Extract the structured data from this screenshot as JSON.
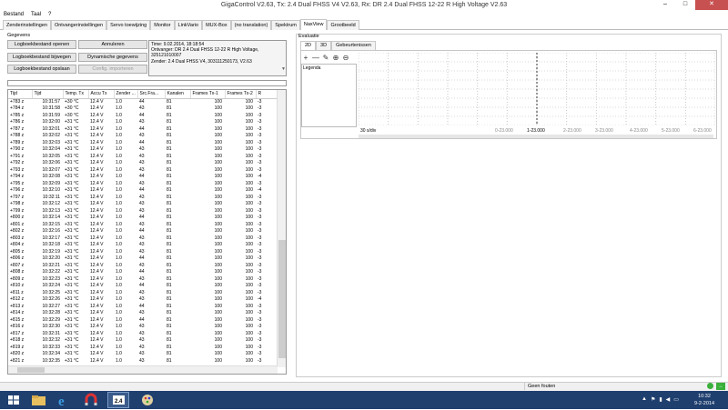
{
  "window": {
    "title": "GigaControl     V2.63,   Tx: 2.4 Dual FHSS V4 V2.63,   Rx: DR 2.4 Dual FHSS 12-22 R High Voltage V2.63",
    "controls": [
      "–",
      "□",
      "✕"
    ]
  },
  "menu": [
    "Bestand",
    "Taal",
    "?"
  ],
  "tabs": [
    "Zenderinstellingen",
    "Ontvangerinstellingen",
    "Servo toewijzing",
    "Monitor",
    "LinkVario",
    "MUX-Box",
    "(no translation)",
    "Spektrum",
    "NaxView",
    "Grootbeeld"
  ],
  "active_tab": "NaxView",
  "gegevens": {
    "label": "Gegevens",
    "buttons": {
      "open": "Logboekbestand openen",
      "cancel": "Annuleren",
      "update": "Logboekbestand bijwegen",
      "dynamic": "Dynamische gegevens",
      "save": "Logboekbestand opslaan",
      "config": "Config. importeren"
    },
    "info": {
      "time": "Time: 9.02.2014, 18:18:54",
      "receiver": "Ontvanger:   DR 2.4 Dual FHSS 12-22 R High Voltage,",
      "receiver_id": "325121010007",
      "transmitter": "Zender:   2.4 Dual FHSS V4, 303111250173, V2.63"
    }
  },
  "table": {
    "columns": [
      "Tijd",
      "Tijd",
      "Temp. Tx",
      "Accu Tx",
      "Zender ...",
      "Src.Fra...",
      "Kanalen",
      "Frames Tx-1",
      "Frames Tx-2",
      "R"
    ],
    "rows": [
      [
        "+783 z",
        "10:31:57",
        "+30 °C",
        "12.4 V",
        "1.0",
        "44",
        "81",
        "100",
        "100",
        "-3"
      ],
      [
        "+784 z",
        "10:31:58",
        "+30 °C",
        "12.4 V",
        "1.0",
        "43",
        "81",
        "100",
        "100",
        "-3"
      ],
      [
        "+785 z",
        "10:31:59",
        "+30 °C",
        "12.4 V",
        "1.0",
        "44",
        "81",
        "100",
        "100",
        "-3"
      ],
      [
        "+786 z",
        "10:32:00",
        "+31 °C",
        "12.4 V",
        "1.0",
        "43",
        "81",
        "100",
        "100",
        "-3"
      ],
      [
        "+787 z",
        "10:32:01",
        "+31 °C",
        "12.4 V",
        "1.0",
        "44",
        "81",
        "100",
        "100",
        "-3"
      ],
      [
        "+788 z",
        "10:32:02",
        "+31 °C",
        "12.4 V",
        "1.0",
        "43",
        "81",
        "100",
        "100",
        "-3"
      ],
      [
        "+789 z",
        "10:32:03",
        "+31 °C",
        "12.4 V",
        "1.0",
        "44",
        "81",
        "100",
        "100",
        "-3"
      ],
      [
        "+790 z",
        "10:32:04",
        "+31 °C",
        "12.4 V",
        "1.0",
        "43",
        "81",
        "100",
        "100",
        "-3"
      ],
      [
        "+791 z",
        "10:32:05",
        "+31 °C",
        "12.4 V",
        "1.0",
        "43",
        "81",
        "100",
        "100",
        "-3"
      ],
      [
        "+792 z",
        "10:32:06",
        "+31 °C",
        "12.4 V",
        "1.0",
        "43",
        "81",
        "100",
        "100",
        "-3"
      ],
      [
        "+793 z",
        "10:32:07",
        "+31 °C",
        "12.4 V",
        "1.0",
        "43",
        "81",
        "100",
        "100",
        "-3"
      ],
      [
        "+794 z",
        "10:32:08",
        "+31 °C",
        "12.4 V",
        "1.0",
        "44",
        "81",
        "100",
        "100",
        "-4"
      ],
      [
        "+795 z",
        "10:32:09",
        "+31 °C",
        "12.4 V",
        "1.0",
        "43",
        "81",
        "100",
        "100",
        "-3"
      ],
      [
        "+796 z",
        "10:32:10",
        "+31 °C",
        "12.4 V",
        "1.0",
        "44",
        "81",
        "100",
        "100",
        "-4"
      ],
      [
        "+797 z",
        "10:32:11",
        "+31 °C",
        "12.4 V",
        "1.0",
        "43",
        "81",
        "100",
        "100",
        "-3"
      ],
      [
        "+798 z",
        "10:32:12",
        "+31 °C",
        "12.4 V",
        "1.0",
        "43",
        "81",
        "100",
        "100",
        "-3"
      ],
      [
        "+799 z",
        "10:32:13",
        "+31 °C",
        "12.4 V",
        "1.0",
        "43",
        "81",
        "100",
        "100",
        "-3"
      ],
      [
        "+800 z",
        "10:32:14",
        "+31 °C",
        "12.4 V",
        "1.0",
        "44",
        "81",
        "100",
        "100",
        "-3"
      ],
      [
        "+801 z",
        "10:32:15",
        "+31 °C",
        "12.4 V",
        "1.0",
        "43",
        "81",
        "100",
        "100",
        "-3"
      ],
      [
        "+802 z",
        "10:32:16",
        "+31 °C",
        "12.4 V",
        "1.0",
        "44",
        "81",
        "100",
        "100",
        "-3"
      ],
      [
        "+803 z",
        "10:32:17",
        "+31 °C",
        "12.4 V",
        "1.0",
        "43",
        "81",
        "100",
        "100",
        "-3"
      ],
      [
        "+804 z",
        "10:32:18",
        "+31 °C",
        "12.4 V",
        "1.0",
        "43",
        "81",
        "100",
        "100",
        "-3"
      ],
      [
        "+805 z",
        "10:32:19",
        "+31 °C",
        "12.4 V",
        "1.0",
        "43",
        "81",
        "100",
        "100",
        "-3"
      ],
      [
        "+806 z",
        "10:32:20",
        "+31 °C",
        "12.4 V",
        "1.0",
        "44",
        "81",
        "100",
        "100",
        "-3"
      ],
      [
        "+807 z",
        "10:32:21",
        "+31 °C",
        "12.4 V",
        "1.0",
        "43",
        "81",
        "100",
        "100",
        "-3"
      ],
      [
        "+808 z",
        "10:32:22",
        "+31 °C",
        "12.4 V",
        "1.0",
        "44",
        "81",
        "100",
        "100",
        "-3"
      ],
      [
        "+809 z",
        "10:32:23",
        "+31 °C",
        "12.4 V",
        "1.0",
        "43",
        "81",
        "100",
        "100",
        "-3"
      ],
      [
        "+810 z",
        "10:32:24",
        "+31 °C",
        "12.4 V",
        "1.0",
        "44",
        "81",
        "100",
        "100",
        "-3"
      ],
      [
        "+811 z",
        "10:32:25",
        "+31 °C",
        "12.4 V",
        "1.0",
        "43",
        "81",
        "100",
        "100",
        "-3"
      ],
      [
        "+812 z",
        "10:32:26",
        "+31 °C",
        "12.4 V",
        "1.0",
        "43",
        "81",
        "100",
        "100",
        "-4"
      ],
      [
        "+813 z",
        "10:32:27",
        "+31 °C",
        "12.4 V",
        "1.0",
        "44",
        "81",
        "100",
        "100",
        "-3"
      ],
      [
        "+814 z",
        "10:32:28",
        "+31 °C",
        "12.4 V",
        "1.0",
        "43",
        "81",
        "100",
        "100",
        "-3"
      ],
      [
        "+815 z",
        "10:32:29",
        "+31 °C",
        "12.4 V",
        "1.0",
        "44",
        "81",
        "100",
        "100",
        "-3"
      ],
      [
        "+816 z",
        "10:32:30",
        "+31 °C",
        "12.4 V",
        "1.0",
        "43",
        "81",
        "100",
        "100",
        "-3"
      ],
      [
        "+817 z",
        "10:32:31",
        "+31 °C",
        "12.4 V",
        "1.0",
        "43",
        "81",
        "100",
        "100",
        "-3"
      ],
      [
        "+818 z",
        "10:32:32",
        "+31 °C",
        "12.4 V",
        "1.0",
        "43",
        "81",
        "100",
        "100",
        "-3"
      ],
      [
        "+819 z",
        "10:32:33",
        "+31 °C",
        "12.4 V",
        "1.0",
        "43",
        "81",
        "100",
        "100",
        "-3"
      ],
      [
        "+820 z",
        "10:32:34",
        "+31 °C",
        "12.4 V",
        "1.0",
        "43",
        "81",
        "100",
        "100",
        "-3"
      ],
      [
        "+821 z",
        "10:32:35",
        "+31 °C",
        "12.4 V",
        "1.0",
        "43",
        "81",
        "100",
        "100",
        "-3"
      ]
    ]
  },
  "evaluatie": {
    "label": "Evaluatie",
    "tabs": [
      "2D",
      "3D",
      "Gebeurtenissen"
    ],
    "active_tab": "2D",
    "tools": [
      "+",
      "—",
      "✎",
      "⊕",
      "⊖"
    ],
    "legend_label": "Legenda",
    "x_axis_labels": [
      "30 s/div",
      "0-23.000",
      "1-23.000",
      "2-23.000",
      "3-23.000",
      "4-23.000",
      "5-23.000",
      "6-23.000"
    ]
  },
  "status": {
    "text": "Geen fouten",
    "arrows": "↔"
  },
  "taskbar": {
    "icons": [
      "windows-logo",
      "file-explorer",
      "internet-explorer",
      "magnet-app",
      "gigacontrol-app",
      "paint-app"
    ],
    "gigacontrol_label": "2.4",
    "time": "10:32",
    "date": "9-2-2014"
  },
  "colors": {
    "taskbar_bg": "#1f3f6f",
    "close_btn": "#c75050",
    "status_ok": "#3ab03a"
  }
}
